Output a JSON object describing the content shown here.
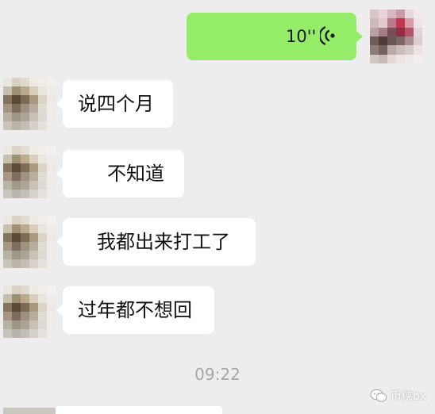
{
  "voice_message": {
    "duration": "10''",
    "icon": "voice-wave-icon",
    "bubble_color": "#95ec69"
  },
  "messages": [
    {
      "text": "说四个月"
    },
    {
      "text": "不知道"
    },
    {
      "text": "我都出来打工了"
    },
    {
      "text": "过年都不想回"
    }
  ],
  "timestamp": "09:22",
  "watermark": {
    "text": "币侠bx",
    "icon": "wechat-logo-icon"
  }
}
